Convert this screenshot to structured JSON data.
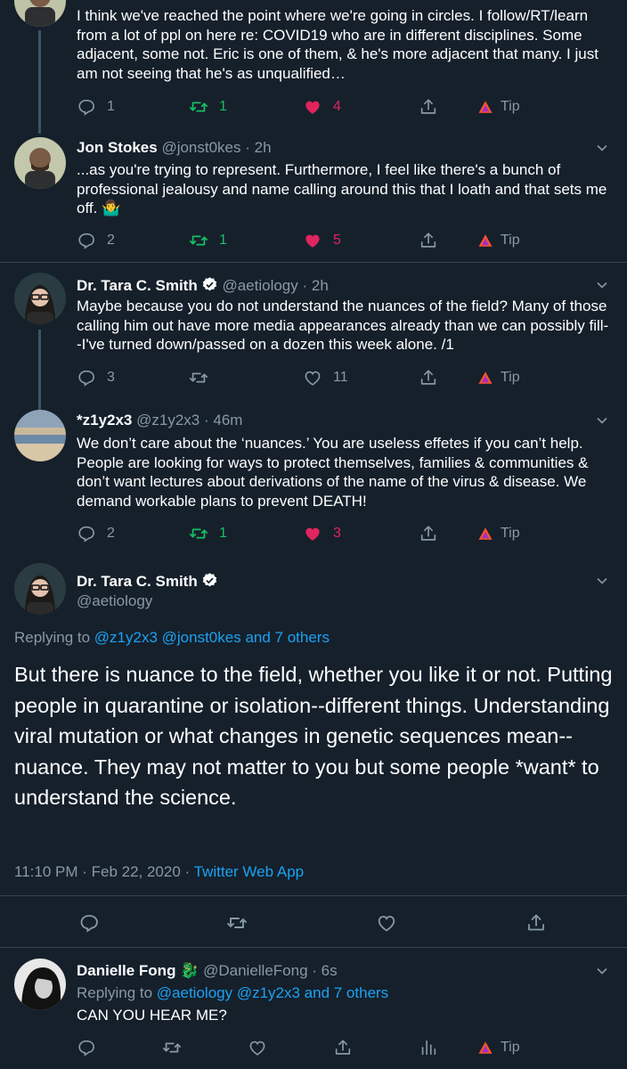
{
  "tweets": [
    {
      "text": "I think we've reached the point where we're going in circles. I follow/RT/learn from a lot of ppl on here re: COVID19 who are in different disciplines. Some adjacent, some not. Eric is one of them, & he's more adjacent that many. I just am not seeing that he's as unqualified…",
      "replies": "1",
      "retweets": "1",
      "likes": "4",
      "tip": "Tip"
    },
    {
      "name": "Jon Stokes",
      "handle": "@jonst0kes",
      "time": "· 2h",
      "text": "...as you're trying to represent. Furthermore, I feel like there's a bunch of professional jealousy and name calling around this that I loath and that sets me off. 🤷‍♂️",
      "replies": "2",
      "retweets": "1",
      "likes": "5",
      "tip": "Tip"
    },
    {
      "name": "Dr. Tara C. Smith",
      "handle": "@aetiology",
      "time": "· 2h",
      "text": "Maybe because you do not understand the nuances of the field? Many of those calling him out have more media appearances already than we can possibly fill--I've turned down/passed on a dozen this week alone. /1",
      "replies": "3",
      "retweets": "",
      "likes": "11",
      "tip": "Tip"
    },
    {
      "name": "*z1y2x3",
      "handle": "@z1y2x3",
      "time": "· 46m",
      "text": "We don’t care about the ‘nuances.’ You are useless effetes if you can’t help. People are looking for ways to protect themselves, families & communities & don’t want lectures about derivations of the name of the virus & disease. We demand workable plans to prevent DEATH!",
      "replies": "2",
      "retweets": "1",
      "likes": "3",
      "tip": "Tip"
    }
  ],
  "focused": {
    "name": "Dr. Tara C. Smith",
    "handle": "@aetiology",
    "replying_prefix": "Replying to",
    "replying_targets": "@z1y2x3 @jonst0kes and 7 others",
    "text": "But there is nuance to the field, whether you like it or not. Putting people in quarantine or isolation--different things. Understanding viral mutation or what changes in genetic sequences mean--nuance. They may not matter to you but some people *want* to understand the science.",
    "timestamp": "11:10 PM · Feb 22, 2020",
    "source_sep": "·",
    "source": "Twitter Web App"
  },
  "reply": {
    "name": "Danielle Fong",
    "emoji": "🐉",
    "handle": "@DanielleFong",
    "time": "· 6s",
    "replying_prefix": "Replying to",
    "replying_targets": "@aetiology @z1y2x3 and 7 others",
    "text": "CAN YOU HEAR ME?",
    "tip": "Tip"
  },
  "colors": {
    "background": "#15202b",
    "link": "#1da1f2",
    "retweet": "#17bf63",
    "like": "#e0245e",
    "muted": "#8899a6",
    "brave": "#fb542b"
  }
}
